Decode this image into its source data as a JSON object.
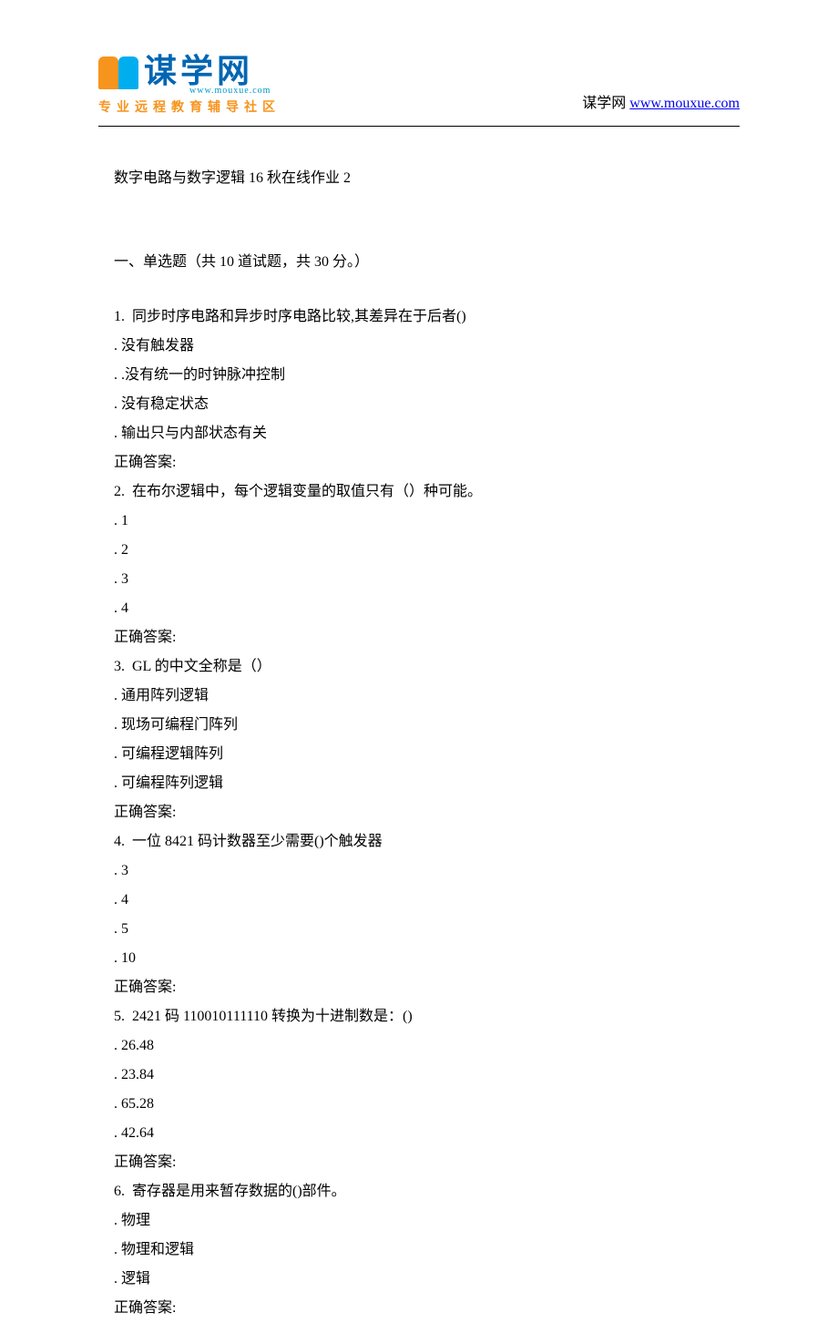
{
  "header": {
    "brand_name": "谋学网",
    "brand_domain_small": "www.mouxue.com",
    "brand_subtitle": "专业远程教育辅导社区",
    "site_label": "谋学网 ",
    "site_link_text": "www.mouxue.com"
  },
  "doc_title": "数字电路与数字逻辑 16 秋在线作业 2",
  "section_title": "一、单选题（共 10 道试题，共 30 分。）",
  "questions": [
    {
      "prompt": "1.  同步时序电路和异步时序电路比较,其差异在于后者()",
      "options": [
        ". 没有触发器",
        ". .没有统一的时钟脉冲控制",
        ". 没有稳定状态",
        ". 输出只与内部状态有关"
      ],
      "answer_label": "正确答案:"
    },
    {
      "prompt": "2.  在布尔逻辑中，每个逻辑变量的取值只有（）种可能。",
      "options": [
        ". 1",
        ". 2",
        ". 3",
        ". 4"
      ],
      "answer_label": "正确答案:"
    },
    {
      "prompt": "3.  GL 的中文全称是（）",
      "options": [
        ". 通用阵列逻辑",
        ". 现场可编程门阵列",
        ". 可编程逻辑阵列",
        ". 可编程阵列逻辑"
      ],
      "answer_label": "正确答案:"
    },
    {
      "prompt": "4.  一位 8421 码计数器至少需要()个触发器",
      "options": [
        ". 3",
        ". 4",
        ". 5",
        ". 10"
      ],
      "answer_label": "正确答案:"
    },
    {
      "prompt": "5.  2421 码 110010111110 转换为十进制数是：()",
      "options": [
        ". 26.48",
        ". 23.84",
        ". 65.28",
        ". 42.64"
      ],
      "answer_label": "正确答案:"
    },
    {
      "prompt": "6.  寄存器是用来暂存数据的()部件。",
      "options": [
        ". 物理",
        ". 物理和逻辑",
        ". 逻辑"
      ],
      "answer_label": "正确答案:"
    }
  ]
}
